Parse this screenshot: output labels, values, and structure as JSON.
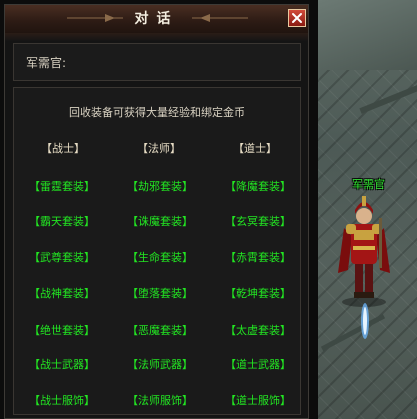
{
  "dialog": {
    "title": "对话",
    "npc_label": "军需官:",
    "intro": "回收装备可获得大量经验和绑定金币",
    "class_headers": [
      "【战士】",
      "【法师】",
      "【道士】"
    ],
    "rows": [
      [
        "【雷霆套装】",
        "【劫邪套装】",
        "【降魔套装】"
      ],
      [
        "【霸天套装】",
        "【诛魔套装】",
        "【玄冥套装】"
      ],
      [
        "【武尊套装】",
        "【生命套装】",
        "【赤霄套装】"
      ],
      [
        "【战神套装】",
        "【堕落套装】",
        "【乾坤套装】"
      ],
      [
        "【绝世套装】",
        "【恶魔套装】",
        "【太虚套装】"
      ],
      [
        "【战士武器】",
        "【法师武器】",
        "【道士武器】"
      ],
      [
        "【战士服饰】",
        "【法师服饰】",
        "【道士服饰】"
      ]
    ]
  },
  "scene": {
    "npc_name": "军需官"
  },
  "colors": {
    "option_text": "#22e622",
    "header_text": "#e6dcc4",
    "title_bar": "#3a2319",
    "close_button": "#b33022"
  },
  "icons": {
    "close": "close-icon"
  }
}
